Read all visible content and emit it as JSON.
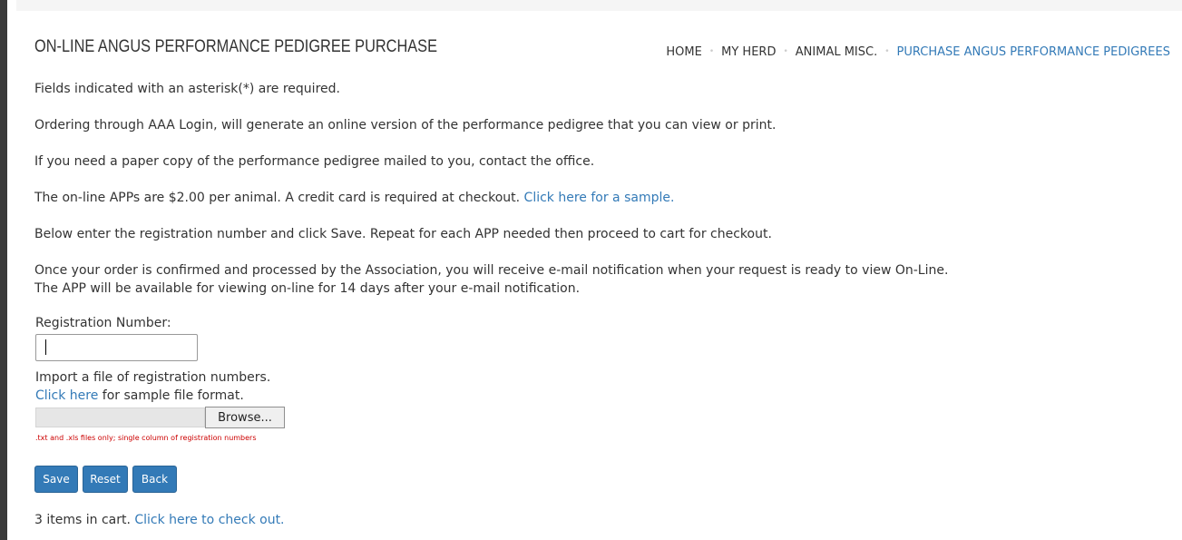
{
  "page": {
    "title": "ON-LINE ANGUS PERFORMANCE PEDIGREE PURCHASE"
  },
  "breadcrumb": {
    "items": [
      "HOME",
      "MY HERD",
      "ANIMAL MISC.",
      "PURCHASE ANGUS PERFORMANCE PEDIGREES"
    ],
    "separator": "•"
  },
  "content": {
    "required_note": "Fields indicated with an asterisk(*) are required.",
    "ordering_note": "Ordering through AAA Login, will generate an online version of the performance pedigree that you can view or print.",
    "paper_note": "If you need a paper copy of the performance pedigree mailed to you, contact the office.",
    "price_note": "The on-line APPs are $2.00 per animal. A credit card is required at checkout.",
    "sample_link": "Click here for a sample.",
    "instructions": "Below enter the registration number and click Save. Repeat for each APP needed then proceed to cart for checkout.",
    "confirm_note_1": "Once your order is confirmed and processed by the Association, you will receive e-mail notification when your request is ready to view On-Line.",
    "confirm_note_2": "The APP will be available for viewing on-line for 14 days after your e-mail notification."
  },
  "form": {
    "registration_label": "Registration Number:",
    "registration_value": "",
    "import_label": "Import a file of registration numbers.",
    "sample_format_link": "Click here",
    "sample_format_text": " for sample file format.",
    "browse_label": "Browse...",
    "file_hint": ".txt and .xls files only; single column of registration numbers"
  },
  "buttons": {
    "save": "Save",
    "reset": "Reset",
    "back": "Back"
  },
  "cart": {
    "count_text": "3 items in cart.",
    "checkout_link": "Click here to check out."
  },
  "colors": {
    "link": "#337ab7",
    "button_bg": "#337ab7",
    "hint": "#cc0000"
  }
}
